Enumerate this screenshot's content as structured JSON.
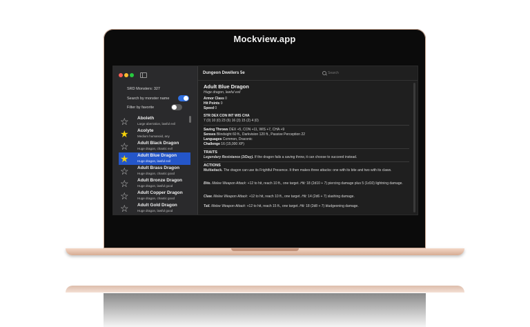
{
  "watermark": "Mockview.app",
  "sidebar": {
    "srd_label": "SRD Monsters: 327",
    "search_by_name_label": "Search by monster name",
    "filter_favorite_label": "Filter by favorite"
  },
  "monsters": [
    {
      "name": "Aboleth",
      "sub": "Large aberration, lawful evil",
      "favorite": false,
      "selected": false
    },
    {
      "name": "Acolyte",
      "sub": "Medium humanoid, any",
      "favorite": true,
      "selected": false
    },
    {
      "name": "Adult Black Dragon",
      "sub": "Huge dragon, chaotic evil",
      "favorite": false,
      "selected": false
    },
    {
      "name": "Adult Blue Dragon",
      "sub": "Huge dragon, lawful evil",
      "favorite": true,
      "selected": true
    },
    {
      "name": "Adult Brass Dragon",
      "sub": "Huge dragon, chaotic good",
      "favorite": false,
      "selected": false
    },
    {
      "name": "Adult Bronze Dragon",
      "sub": "Huge dragon, lawful good",
      "favorite": false,
      "selected": false
    },
    {
      "name": "Adult Copper Dragon",
      "sub": "Huge dragon, chaotic good",
      "favorite": false,
      "selected": false
    },
    {
      "name": "Adult Gold Dragon",
      "sub": "Huge dragon, lawful good",
      "favorite": false,
      "selected": false
    }
  ],
  "header": {
    "title": "Dungeon Dwellers 5e",
    "search_placeholder": "Search"
  },
  "detail": {
    "name": "Adult Blue Dragon",
    "type": "Huge dragon, lawful evil",
    "armor_class_label": "Armor Class",
    "armor_class": "0",
    "hit_points_label": "Hit Points",
    "hit_points": "0",
    "speed_label": "Speed",
    "speed": "0",
    "ability_header": "STR   DEX   CON   INT   WIS   CHA",
    "ability_values": "7 (0)  10 (0)  23 (6)  16 (3)  15 (2)  4 (0)",
    "saving_throws_label": "Saving Throws",
    "saving_throws": "DEX +5, CON +11, WIS +7, CHA +9",
    "senses_label": "Senses",
    "senses": "Blindsight 60 ft., Darkvision 120 ft., Passive Perception 22",
    "languages_label": "Languages",
    "languages": "Common, Draconic",
    "challenge_label": "Challenge",
    "challenge": "16 (15,000 XP)",
    "traits_heading": "TRAITS",
    "trait_name": "Legendary Resistance (3/Day).",
    "trait_text": "If the dragon fails a saving throw, it can choose to succeed instead.",
    "actions_heading": "ACTIONS",
    "multiattack_name": "Multiattack.",
    "multiattack_text": "The dragon can use its Frightful Presence. It then makes three attacks: one with its bite and two with its claws.",
    "bite_name": "Bite.",
    "bite_kind": "Melee Weapon Attack:",
    "bite_text": "+12 to hit, reach 10 ft., one target.",
    "bite_hit": "Hit:",
    "bite_damage": "18 (2d10 + 7) piercing damage plus 5 (1d10) lightning damage.",
    "claw_name": "Claw.",
    "claw_kind": "Melee Weapon Attack:",
    "claw_text": "+12 to hit, reach 10 ft., one target.",
    "claw_hit": "Hit:",
    "claw_damage": "14 (2d6 + 7) slashing damage.",
    "tail_name": "Tail.",
    "tail_kind": "Melee Weapon Attack:",
    "tail_text": "+12 to hit, reach 15 ft., one target.",
    "tail_hit": "Hit:",
    "tail_damage": "18 (2d8 + 7) bludgeoning damage."
  }
}
